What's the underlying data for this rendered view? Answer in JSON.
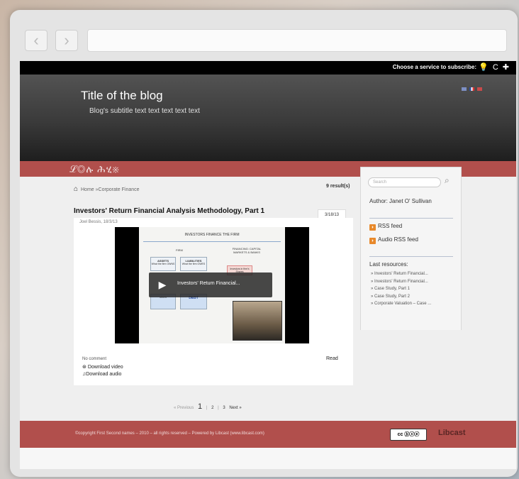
{
  "browser": {
    "back_icon": "‹",
    "forward_icon": "›",
    "url": ""
  },
  "topbar": {
    "subscribe_label": "Choose a service to subscribe:",
    "icons": [
      "bulb-icon",
      "refresh-icon",
      "plus-icon"
    ]
  },
  "header": {
    "title": "Title of the blog",
    "subtitle": "Blog's subtitle text text text text text",
    "flag_colors": [
      "#7d8fc4",
      "#e9e9e9",
      "#c94a4a"
    ]
  },
  "band": {
    "logo_text": "ℒ◎ሉ ሕሂ※"
  },
  "breadcrumb": {
    "home": "Home",
    "separator": "»",
    "current": "Corporate Finance"
  },
  "results": "9 result(s)",
  "post": {
    "title": "Investors' Return Financial Analysis Methodology, Part 1",
    "date": "3/18/13",
    "meta": "Joel Bessis, 18/3/13",
    "comments": "No comment",
    "download_video": "Download video",
    "download_audio": "Download audio",
    "read": "Read",
    "video": {
      "caption": "Investors' Return Financial...",
      "slide_heading": "INVESTORS FINANCE THE FIRM",
      "slide_firm": "FIRM",
      "slide_financing": "FINANCING: CAPITAL MARKETS & BANKS",
      "box_assets": "ASSETS",
      "box_assets_sub": "What the firm OWNS",
      "box_liabilities": "LIABILITIES",
      "box_liabilities_sub": "What the firm OWES",
      "box_investors": "Investors in firm's Shares",
      "box_debt": "DEBT",
      "box_others": "others"
    }
  },
  "pagination": {
    "previous": "« Previous",
    "current": "1",
    "separator": "|",
    "pages": [
      "2",
      "3"
    ],
    "next": "Next »"
  },
  "sidebar": {
    "search_placeholder": "Search",
    "author": "Author: Janet O' Sullivan",
    "rss_feed": "RSS feed",
    "audio_rss_feed": "Audio RSS feed",
    "last_resources_title": "Last resources:",
    "resources": [
      "» Investors' Return Financial...",
      "» Investors' Return Financial...",
      "» Case Study, Part 1",
      "» Case Study, Part 2",
      "» Corporate Valuation – Case ..."
    ]
  },
  "footer": {
    "copyright": "©copyright First Second names  –  2010  –  all rights reserved  –  Powered by Libcast (www.libcast.com)",
    "cc_badge": "cc ⓑⓢⓔ",
    "logo": "Libcast"
  },
  "colors": {
    "accent_red": "#b14f4c",
    "header_dark": "#3a3a3a",
    "rss_orange": "#e8892b"
  }
}
